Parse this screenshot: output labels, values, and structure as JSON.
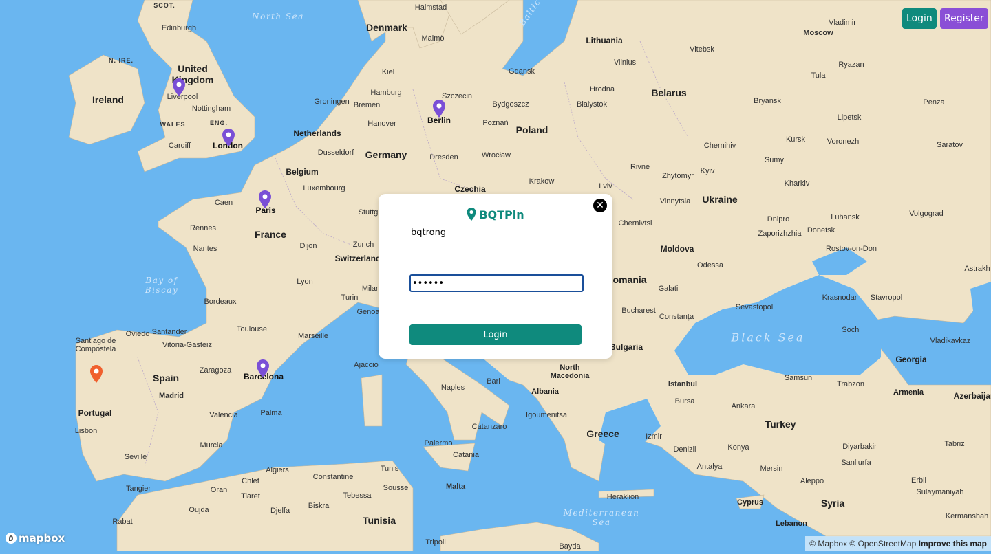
{
  "header": {
    "login_label": "Login",
    "register_label": "Register"
  },
  "brand": {
    "name": "BQTPin",
    "accent": "#0f8a7d",
    "register_color": "#8a4fd6"
  },
  "login_form": {
    "username_value": "bqtrong",
    "password_value": "••••••",
    "submit_label": "Login",
    "close_icon": "close-icon"
  },
  "map": {
    "countries": [
      "Ireland",
      "United Kingdom",
      "France",
      "Spain",
      "Portugal",
      "Germany",
      "Netherlands",
      "Belgium",
      "Luxembourg",
      "Switzerland",
      "Denmark",
      "Lithuania",
      "Belarus",
      "Poland",
      "Czechia",
      "Ukraine",
      "Moldova",
      "Romania",
      "Bulgaria",
      "North Macedonia",
      "Albania",
      "Greece",
      "Turkey",
      "Georgia",
      "Armenia",
      "Azerbaijan",
      "Syria",
      "Cyprus",
      "Lebanon",
      "Tunisia"
    ],
    "regions": [
      "SCOT.",
      "N. IRE.",
      "WALES",
      "ENG."
    ],
    "water": [
      "North Sea",
      "Baltic",
      "Bay of Biscay",
      "Black Sea",
      "Mediterranean Sea"
    ],
    "cities": [
      "Edinburgh",
      "Liverpool",
      "Nottingham",
      "Cardiff",
      "Halmstad",
      "Malmö",
      "Kiel",
      "Hamburg",
      "Groningen",
      "Bremen",
      "Hanover",
      "Szczecin",
      "Gdansk",
      "Bydgoszcz",
      "Poznań",
      "Wrocław",
      "Dresden",
      "Dusseldorf",
      "Krakow",
      "Caen",
      "Rennes",
      "Nantes",
      "Dijon",
      "Lyon",
      "Bordeaux",
      "Toulouse",
      "Marseille",
      "Zurich",
      "Stuttg",
      "Milan",
      "Turin",
      "Genoa",
      "Santiago de Compostela",
      "Oviedo",
      "Santander",
      "Vitoria-Gasteiz",
      "Zaragoza",
      "Madrid",
      "Valencia",
      "Murcia",
      "Lisbon",
      "Seville",
      "Palma",
      "Ajaccio",
      "Naples",
      "Bari",
      "Catanzaro",
      "Palermo",
      "Catania",
      "Algiers",
      "Constantine",
      "Tunis",
      "Chlef",
      "Oran",
      "Tiaret",
      "Tebessa",
      "Sousse",
      "Djelfa",
      "Biskra",
      "Tangier",
      "Oujda",
      "Rabat",
      "Tripoli",
      "Malta",
      "Igoumenitsa",
      "Heraklion",
      "Izmir",
      "Denizli",
      "Antalya",
      "Mersin",
      "Konya",
      "Ankara",
      "Istanbul",
      "Bursa",
      "Samsun",
      "Trabzon",
      "Diyarbakir",
      "Sanliurfa",
      "Aleppo",
      "Erbil",
      "Sulaymaniyah",
      "Kermanshah",
      "Tabriz",
      "Vladikavkaz",
      "Sochi",
      "Krasnodar",
      "Stavropol",
      "Sevastopol",
      "Odessa",
      "Galati",
      "Constanța",
      "Bucharest",
      "Chernivtsi",
      "Vinnytsia",
      "Zhytomyr",
      "Rivne",
      "Lviv",
      "Kyiv",
      "Dnipro",
      "Zaporizhzhia",
      "Donetsk",
      "Luhansk",
      "Kharkiv",
      "Sumy",
      "Chernihiv",
      "Kursk",
      "Voronezh",
      "Lipetsk",
      "Bryansk",
      "Tula",
      "Ryazan",
      "Vladimir",
      "Moscow",
      "Vitebsk",
      "Vilnius",
      "Hrodna",
      "Bialystok",
      "Penza",
      "Saratov",
      "Volgograd",
      "Rostov-on-Don",
      "Astrakh",
      "Bayda"
    ],
    "pins": [
      "Liverpool",
      "London",
      "Berlin",
      "Paris",
      "Barcelona",
      "Porto"
    ],
    "pin_labels": [
      "London",
      "Berlin",
      "Paris",
      "Barcelona"
    ],
    "land_color": "#efe3c8",
    "water_color": "#6ab6f0"
  },
  "footer": {
    "logo_text": "mapbox",
    "attribution": "© Mapbox © OpenStreetMap",
    "improve_link": "Improve this map"
  }
}
